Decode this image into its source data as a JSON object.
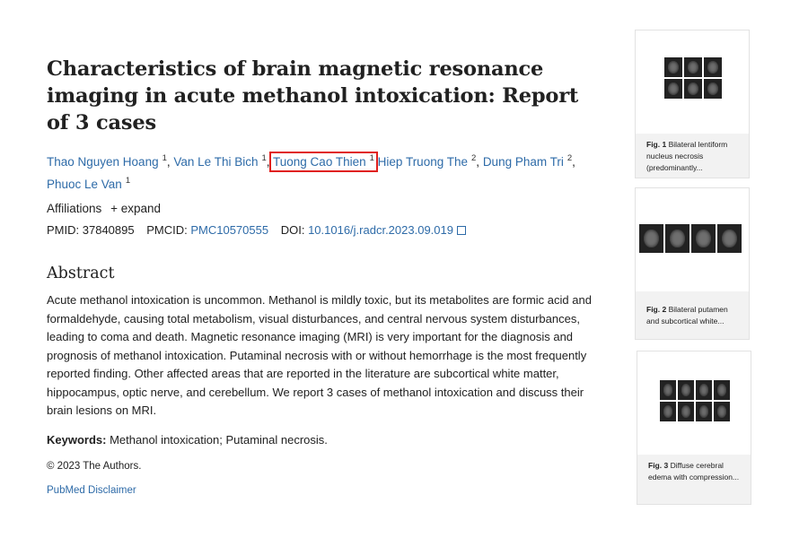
{
  "title": "Characteristics of brain magnetic resonance imaging in acute methanol intoxication: Report of 3 cases",
  "authors": [
    {
      "name": "Thao Nguyen Hoang",
      "aff": "1"
    },
    {
      "name": "Van Le Thi Bich",
      "aff": "1"
    },
    {
      "name": "Tuong Cao Thien",
      "aff": "1"
    },
    {
      "name": "Hiep Truong The",
      "aff": "2"
    },
    {
      "name": "Dung Pham Tri",
      "aff": "2"
    },
    {
      "name": "Phuoc Le Van",
      "aff": "1"
    }
  ],
  "affiliations": {
    "label": "Affiliations",
    "expand": "expand",
    "expand_icon": "plus-icon"
  },
  "ids": {
    "pmid_label": "PMID:",
    "pmid": "37840895",
    "pmcid_label": "PMCID:",
    "pmcid": "PMC10570555",
    "doi_label": "DOI:",
    "doi": "10.1016/j.radcr.2023.09.019"
  },
  "abstract": {
    "heading": "Abstract",
    "text": "Acute methanol intoxication is uncommon. Methanol is mildly toxic, but its metabolites are formic acid and formaldehyde, causing total metabolism, visual disturbances, and central nervous system disturbances, leading to coma and death. Magnetic resonance imaging (MRI) is very important for the diagnosis and prognosis of methanol intoxication. Putaminal necrosis with or without hemorrhage is the most frequently reported finding. Other affected areas that are reported in the literature are subcortical white matter, hippocampus, optic nerve, and cerebellum. We report 3 cases of methanol intoxication and discuss their brain lesions on MRI."
  },
  "keywords": {
    "label": "Keywords:",
    "text": "Methanol intoxication; Putaminal necrosis."
  },
  "copyright": "© 2023 The Authors.",
  "disclaimer": "PubMed Disclaimer",
  "figures": [
    {
      "label": "Fig. 1",
      "caption": "Bilateral lentiform nucleus necrosis (predominantly..."
    },
    {
      "label": "Fig. 2",
      "caption": "Bilateral putamen and subcortical white..."
    },
    {
      "label": "Fig. 3",
      "caption": "Diffuse cerebral edema with compression..."
    }
  ],
  "colors": {
    "link": "#2e6ba8",
    "highlight": "#e0201d"
  }
}
